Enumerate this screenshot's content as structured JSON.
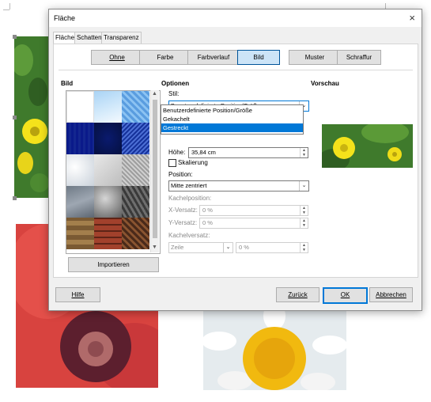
{
  "dialog": {
    "title": "Fläche",
    "close_glyph": "×"
  },
  "tabs": [
    "Fläche",
    "Schatten",
    "Transparenz"
  ],
  "style_buttons": [
    "Ohne",
    "Farbe",
    "Farbverlauf",
    "Bild",
    "Muster",
    "Schraffur"
  ],
  "active_style": "Bild",
  "sections": {
    "image": "Bild",
    "options": "Optionen",
    "preview": "Vorschau"
  },
  "options": {
    "style_label": "Stil:",
    "style_value": "Benutzerdefinierte Position/Größe",
    "style_options": [
      "Benutzerdefinierte Position/Größe",
      "Gekachelt",
      "Gestreckt"
    ],
    "selected_option": "Gestreckt",
    "height_label": "Höhe:",
    "height_value": "35,84 cm",
    "scaling_label": "Skalierung",
    "position_label": "Position:",
    "position_value": "Mitte zentriert",
    "tile_position_label": "Kachelposition:",
    "x_offset_label": "X-Versatz:",
    "x_offset_value": "0 %",
    "y_offset_label": "Y-Versatz:",
    "y_offset_value": "0 %",
    "tile_offset_label": "Kachelversatz:",
    "tile_offset_value": "Zeile",
    "tile_offset_percent": "0 %"
  },
  "import_button": "Importieren",
  "footer": {
    "help": "Hilfe",
    "reset": "Zurück",
    "ok": "OK",
    "cancel": "Abbrechen"
  },
  "colors": {
    "accent": "#0078d7",
    "active_tab_bg": "#cce4f7"
  }
}
